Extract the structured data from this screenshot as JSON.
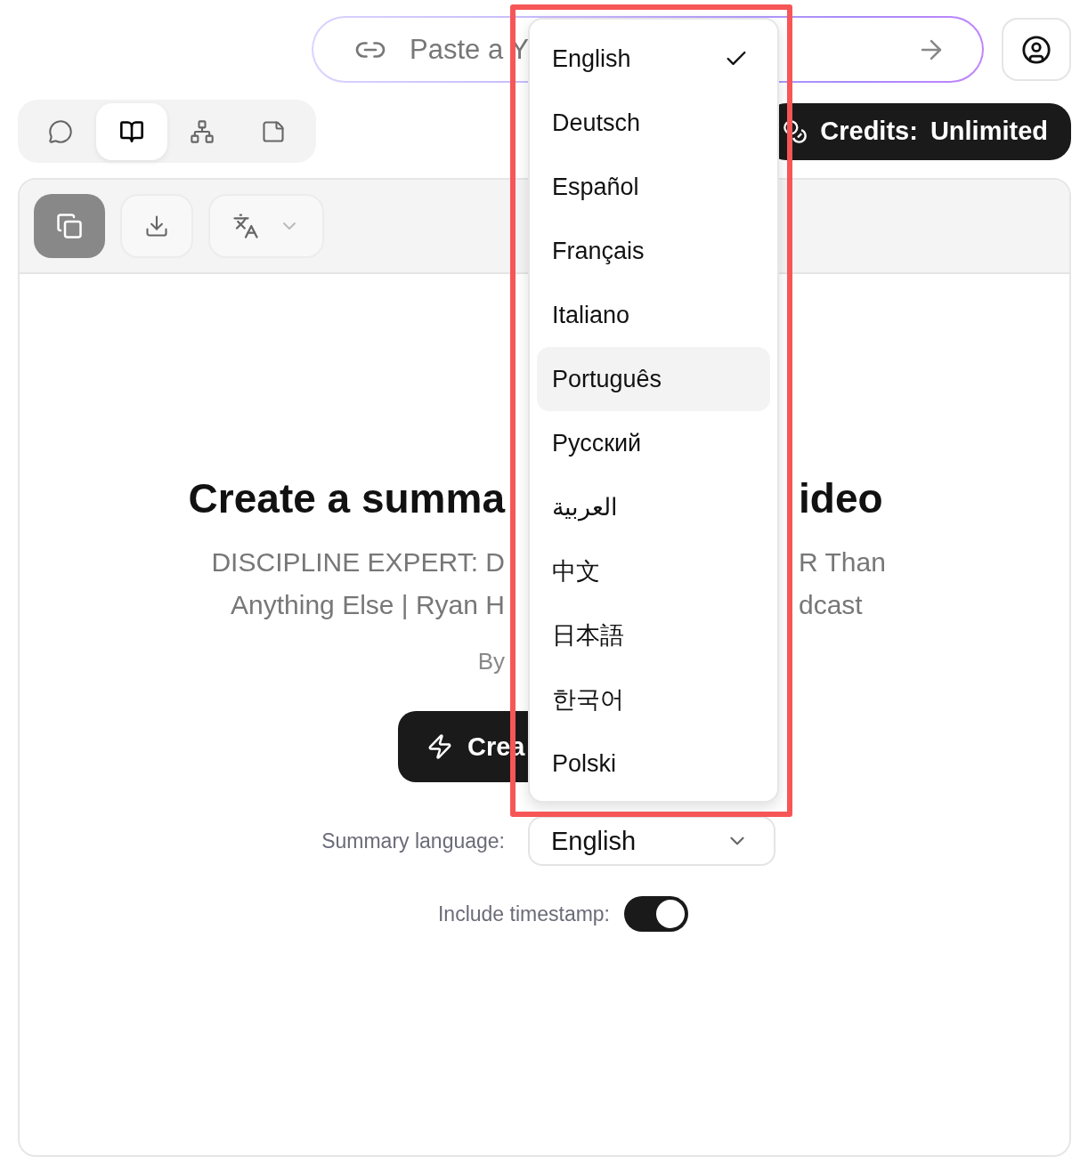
{
  "search": {
    "placeholder": "Paste a Y"
  },
  "view_tabs": [
    {
      "selected": false
    },
    {
      "selected": true
    },
    {
      "selected": false
    },
    {
      "selected": false
    }
  ],
  "credits": {
    "label": "Credits:",
    "value": "Unlimited"
  },
  "summary": {
    "title_left": "Create a summa",
    "title_right": "ideo",
    "subtitle_lines": [
      {
        "left": "DISCIPLINE EXPERT: D",
        "right": "R Than"
      },
      {
        "left": "Anything Else | Ryan H",
        "right": "dcast"
      }
    ],
    "byline": "By",
    "create_button": "Crea",
    "language_label": "Summary language:",
    "language_value": "English",
    "timestamp_label": "Include timestamp:",
    "timestamp_on": true
  },
  "language_menu": [
    {
      "label": "English",
      "selected": true,
      "highlighted": false
    },
    {
      "label": "Deutsch",
      "selected": false,
      "highlighted": false
    },
    {
      "label": "Español",
      "selected": false,
      "highlighted": false
    },
    {
      "label": "Français",
      "selected": false,
      "highlighted": false
    },
    {
      "label": "Italiano",
      "selected": false,
      "highlighted": false
    },
    {
      "label": "Português",
      "selected": false,
      "highlighted": true
    },
    {
      "label": "Русский",
      "selected": false,
      "highlighted": false
    },
    {
      "label": "العربية",
      "selected": false,
      "highlighted": false
    },
    {
      "label": "中文",
      "selected": false,
      "highlighted": false
    },
    {
      "label": "日本語",
      "selected": false,
      "highlighted": false
    },
    {
      "label": "한국어",
      "selected": false,
      "highlighted": false
    },
    {
      "label": "Polski",
      "selected": false,
      "highlighted": false
    }
  ]
}
